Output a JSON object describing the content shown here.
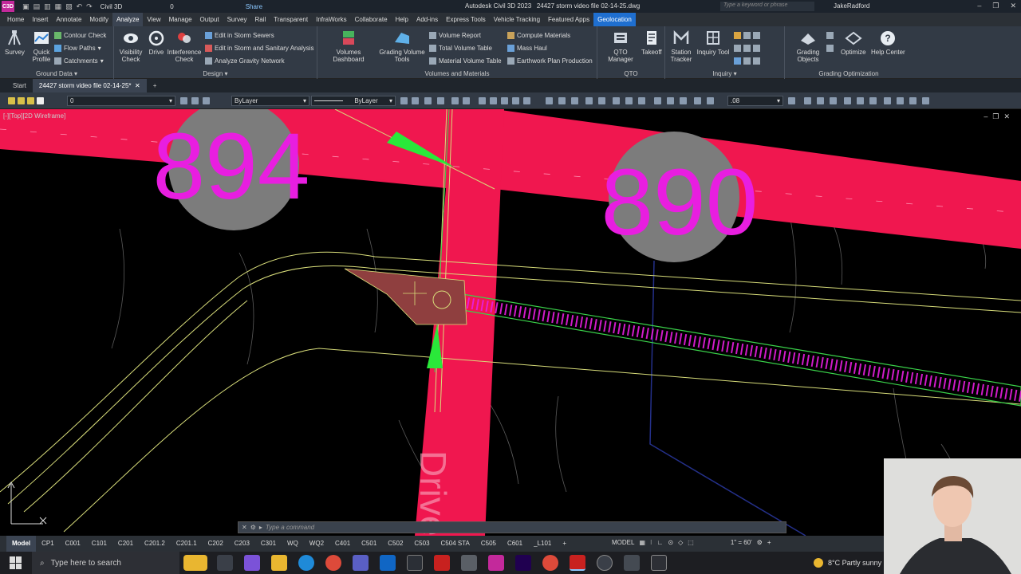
{
  "titlebar": {
    "logo": "C3D",
    "workspace": "Civil 3D",
    "layer_field": "0",
    "share": "Share",
    "app_title": "Autodesk Civil 3D 2023",
    "file_title": "24427 storm video file 02-14-25.dwg",
    "search_placeholder": "Type a keyword or phrase",
    "user": "JakeRadford"
  },
  "menu": {
    "tabs": [
      "Home",
      "Insert",
      "Annotate",
      "Modify",
      "Analyze",
      "View",
      "Manage",
      "Output",
      "Survey",
      "Rail",
      "Transparent",
      "InfraWorks",
      "Collaborate",
      "Help",
      "Add-ins",
      "Express Tools",
      "Vehicle Tracking",
      "Featured Apps",
      "Geolocation"
    ],
    "active": "Analyze"
  },
  "ribbon": {
    "ground_data": {
      "title": "Ground Data",
      "survey": "Survey",
      "quick_profile": "Quick Profile",
      "contour_check": "Contour Check",
      "flow_paths": "Flow Paths",
      "catchments": "Catchments"
    },
    "design": {
      "title": "Design",
      "visibility_check": "Visibility Check",
      "drive": "Drive",
      "interference_check": "Interference Check",
      "edit_storm": "Edit in Storm Sewers",
      "edit_storm_sanitary": "Edit in Storm and Sanitary Analysis",
      "gravity_network": "Analyze Gravity Network"
    },
    "volumes": {
      "title": "Volumes and Materials",
      "dashboard": "Volumes Dashboard",
      "grading_volume": "Grading Volume Tools",
      "volume_report": "Volume Report",
      "total_volume_table": "Total Volume Table",
      "material_volume_table": "Material Volume Table",
      "compute_materials": "Compute Materials",
      "mass_haul": "Mass Haul",
      "earthwork": "Earthwork Plan Production"
    },
    "qto": {
      "title": "QTO",
      "manager": "QTO Manager",
      "takeoff": "Takeoff"
    },
    "inquiry": {
      "title": "Inquiry",
      "station_tracker": "Station Tracker",
      "inquiry_tool": "Inquiry Tool"
    },
    "grading_opt": {
      "title": "Grading Optimization",
      "grading_objects": "Grading Objects",
      "optimize": "Optimize",
      "help_center": "Help Center"
    }
  },
  "file_tabs": {
    "start": "Start",
    "active": "24427 storm video file 02-14-25*"
  },
  "properties": {
    "layer": "0",
    "color": "ByLayer",
    "linetype": "ByLayer",
    "lineweight": ".08"
  },
  "viewport": {
    "label": "[-][Top][2D Wireframe]",
    "lot_left": "894",
    "lot_right": "890",
    "street": "Drive"
  },
  "command": {
    "placeholder": "Type a command"
  },
  "layouts": [
    "Model",
    "CP1",
    "C001",
    "C101",
    "C201",
    "C201.2",
    "C201.1",
    "C202",
    "C203",
    "C301",
    "WQ",
    "WQ2",
    "C401",
    "C501",
    "C502",
    "C503",
    "C504 STA",
    "C505",
    "C601",
    "_L101"
  ],
  "status": {
    "model": "MODEL",
    "scale": "1\" = 60'"
  },
  "taskbar": {
    "search": "Type here to search",
    "weather": "8°C  Partly sunny"
  },
  "colors": {
    "road": "#f0174f",
    "label": "#e81ee0",
    "circle": "#7c7c7c",
    "pad": "#8f3f3f",
    "linework": "#d8dd7a"
  }
}
